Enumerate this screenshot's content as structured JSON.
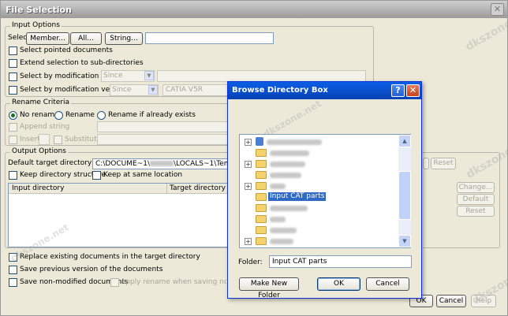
{
  "window": {
    "title": "File Selection",
    "close_glyph": "✕"
  },
  "input_options": {
    "legend": "Input Options",
    "select_label": "Select",
    "member_button": "Member...",
    "all_button": "All...",
    "string_button": "String...",
    "select_pointed": "Select pointed documents",
    "extend_selection": "Extend selection to sub-directories",
    "select_by_date": "Select by modification date",
    "date_combo_value": "Since",
    "select_by_version": "Select by modification version",
    "version_combo_value": "Since",
    "version_field_value": "CATIA V5R"
  },
  "rename_criteria": {
    "legend": "Rename Criteria",
    "no_rename": "No rename",
    "rename": "Rename",
    "rename_if_exists": "Rename if already exists",
    "append_string": "Append string",
    "insert": "Insert",
    "substitute": "Substitute"
  },
  "output_options": {
    "legend": "Output Options",
    "default_target_label": "Default target directory",
    "default_target_value_prefix": "C:\\DOCUME~1\\",
    "default_target_value_suffix": "\\LOCALS~1\\Temp",
    "keep_structure": "Keep directory structure",
    "keep_location": "Keep at same location",
    "col_input": "Input directory",
    "col_target": "Target directory",
    "reset_button": "Reset",
    "change_button": "Change...",
    "default_button": "Default",
    "reset2_button": "Reset"
  },
  "bottom": {
    "replace_existing": "Replace existing documents in the target directory",
    "save_previous": "Save previous version of the documents",
    "save_non_modified": "Save non-modified documents",
    "apply_rename": "Apply rename when saving non-modified",
    "ok_button": "OK",
    "cancel_button": "Cancel",
    "help_button": "Help"
  },
  "browse": {
    "title": "Browse Directory Box",
    "help_glyph": "?",
    "close_glyph": "✕",
    "selected_node": "Input CAT parts",
    "folder_label": "Folder:",
    "folder_value": "Input CAT parts",
    "make_new_folder": "Make New Folder",
    "ok": "OK",
    "cancel": "Cancel"
  },
  "watermark": "dkszone.net",
  "colors": {
    "xp_title_blue": "#0a5ee6",
    "dialog_face": "#ece9d8",
    "selection": "#316ac5"
  }
}
